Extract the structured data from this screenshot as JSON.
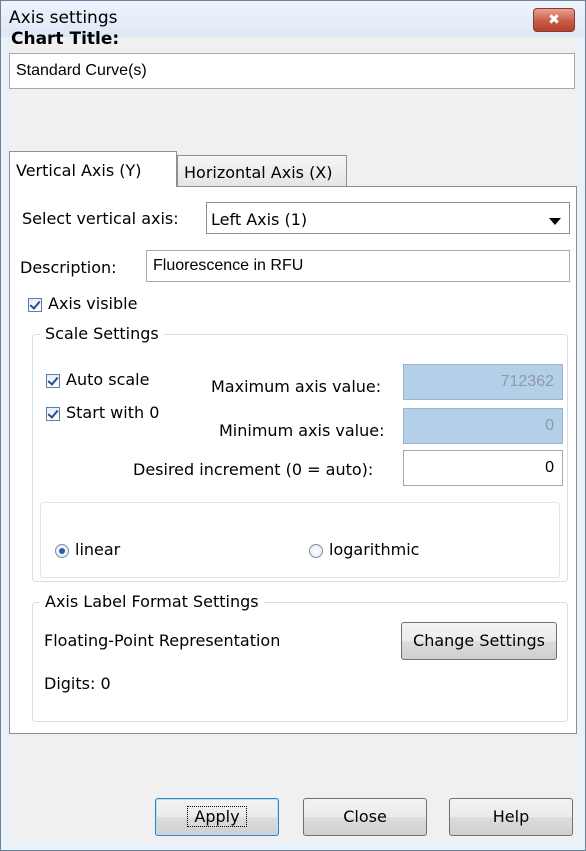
{
  "window": {
    "title": "Axis settings",
    "close_glyph": "✖"
  },
  "chart_title": {
    "label": "Chart Title:",
    "value": "Standard Curve(s)"
  },
  "tabs": [
    {
      "label": "Vertical Axis (Y)",
      "active": true
    },
    {
      "label": "Horizontal Axis (X)",
      "active": false
    }
  ],
  "vertical_axis": {
    "select_label": "Select vertical axis:",
    "selected": "Left Axis (1)",
    "description_label": "Description:",
    "description_value": "Fluorescence in RFU",
    "axis_visible_label": "Axis visible",
    "axis_visible": true
  },
  "scale": {
    "title": "Scale Settings",
    "auto_scale_label": "Auto scale",
    "auto_scale": true,
    "start_zero_label": "Start with 0",
    "start_zero": true,
    "max_label": "Maximum axis value:",
    "max_value": "712362",
    "min_label": "Minimum axis value:",
    "min_value": "0",
    "increment_label": "Desired increment (0 = auto):",
    "increment_value": "0",
    "linear_label": "linear",
    "log_label": "logarithmic",
    "mode": "linear"
  },
  "label_format": {
    "title": "Axis Label Format Settings",
    "representation": "Floating-Point Representation",
    "digits": "Digits: 0",
    "change_button": "Change Settings"
  },
  "buttons": {
    "apply": "Apply",
    "close": "Close",
    "help": "Help"
  }
}
